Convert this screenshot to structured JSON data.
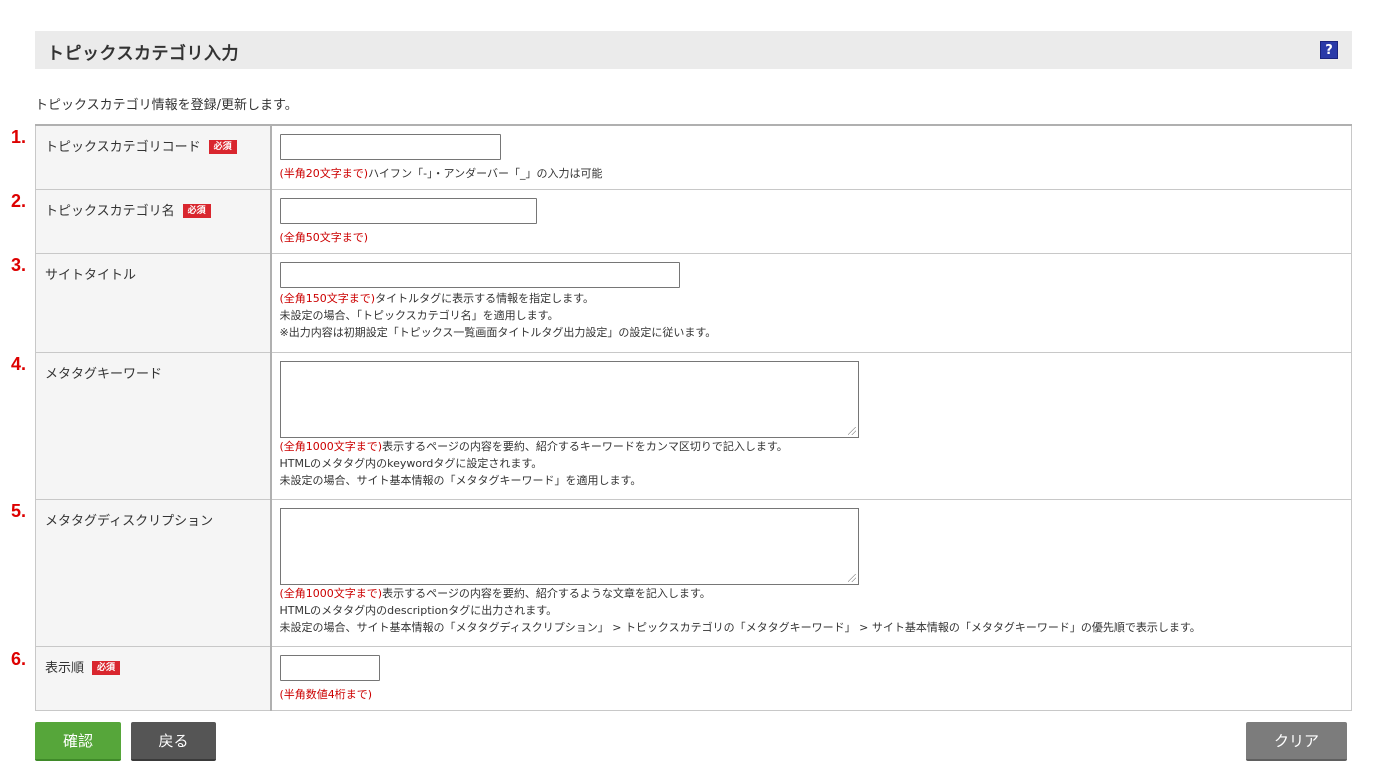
{
  "header": {
    "title": "トピックスカテゴリ入力",
    "help_label": "?"
  },
  "intro": "トピックスカテゴリ情報を登録/更新します。",
  "required_badge": "必須",
  "fields": [
    {
      "num": "1.",
      "label": "トピックスカテゴリコード",
      "required": true,
      "hint_red": "(半角20文字まで)",
      "hint": "ハイフン「-」・アンダーバー「_」の入力は可能",
      "extra": []
    },
    {
      "num": "2.",
      "label": "トピックスカテゴリ名",
      "required": true,
      "hint_red": "(全角50文字まで)",
      "hint": "",
      "extra": []
    },
    {
      "num": "3.",
      "label": "サイトタイトル",
      "required": false,
      "hint_red": "(全角150文字まで)",
      "hint": "タイトルタグに表示する情報を指定します。",
      "extra": [
        "未設定の場合、「トピックスカテゴリ名」を適用します。",
        "※出力内容は初期設定「トピックス一覧画面タイトルタグ出力設定」の設定に従います。"
      ]
    },
    {
      "num": "4.",
      "label": "メタタグキーワード",
      "required": false,
      "hint_red": "(全角1000文字まで)",
      "hint": "表示するページの内容を要約、紹介するキーワードをカンマ区切りで記入します。",
      "extra": [
        "HTMLのメタタグ内のkeywordタグに設定されます。",
        "未設定の場合、サイト基本情報の「メタタグキーワード」を適用します。"
      ]
    },
    {
      "num": "5.",
      "label": "メタタグディスクリプション",
      "required": false,
      "hint_red": "(全角1000文字まで)",
      "hint": "表示するページの内容を要約、紹介するような文章を記入します。",
      "extra": [
        "HTMLのメタタグ内のdescriptionタグに出力されます。",
        "未設定の場合、サイト基本情報の「メタタグディスクリプション」 > トピックスカテゴリの「メタタグキーワード」 > サイト基本情報の「メタタグキーワード」の優先順で表示します。"
      ]
    },
    {
      "num": "6.",
      "label": "表示順",
      "required": true,
      "hint_red": "(半角数値4桁まで)",
      "hint": "",
      "extra": []
    }
  ],
  "buttons": {
    "confirm": "確認",
    "back": "戻る",
    "clear": "クリア"
  },
  "colors": {
    "confirm": "#56a63a",
    "back": "#555555",
    "clear": "#7c7c7c",
    "required": "#d9262e",
    "number": "#dd0000"
  }
}
